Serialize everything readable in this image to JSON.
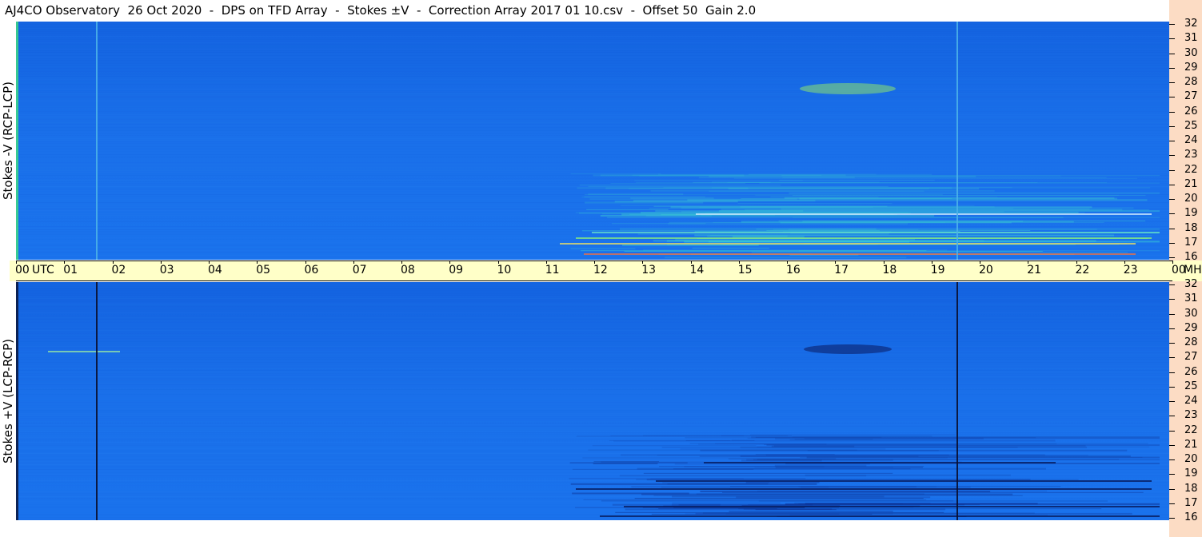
{
  "header": {
    "title": "AJ4CO Observatory  26 Oct 2020  -  DPS on TFD Array  -  Stokes ±V  -  Correction Array 2017 01 10.csv  -  Offset 50  Gain 2.0"
  },
  "chart_data": [
    {
      "type": "heatmap",
      "name": "Stokes -V (RCP-LCP)",
      "ylabel": "Stokes -V (RCP-LCP)",
      "y_ticks": [
        "32",
        "31",
        "30",
        "29",
        "28",
        "27",
        "26",
        "25",
        "24",
        "23",
        "22",
        "21",
        "20",
        "19",
        "18",
        "17",
        "16"
      ],
      "ylim": [
        16,
        32
      ],
      "xlim": [
        0,
        24
      ],
      "grid": false
    },
    {
      "type": "heatmap",
      "name": "Stokes +V (LCP-RCP)",
      "ylabel": "Stokes +V (LCP-RCP)",
      "y_ticks": [
        "32",
        "31",
        "30",
        "29",
        "28",
        "27",
        "26",
        "25",
        "24",
        "23",
        "22",
        "21",
        "20",
        "19",
        "18",
        "17",
        "16"
      ],
      "ylim": [
        16,
        32
      ],
      "xlim": [
        0,
        24
      ],
      "grid": false
    }
  ],
  "time_axis": {
    "ticks": [
      "00",
      "01",
      "02",
      "03",
      "04",
      "05",
      "06",
      "07",
      "08",
      "09",
      "10",
      "11",
      "12",
      "13",
      "14",
      "15",
      "16",
      "17",
      "18",
      "19",
      "20",
      "21",
      "22",
      "23",
      "00"
    ],
    "utc_label": "UTC",
    "unit_label": "MHz"
  },
  "colors": {
    "background": "#1a6ee8",
    "freq_strip": "#fcdcc4",
    "time_axis_bg": "#ffffc8"
  }
}
